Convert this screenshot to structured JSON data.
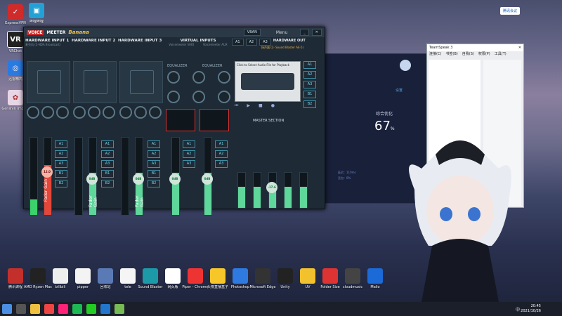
{
  "desktop_left": [
    {
      "label": "ExpressVPN",
      "color": "#d02b2b",
      "t": "✓"
    },
    {
      "label": "VRChat",
      "color": "#222",
      "t": "VR"
    },
    {
      "label": "迅雷精简",
      "color": "#2a7ae2",
      "t": "◎"
    },
    {
      "label": "Genshin Impact",
      "color": "#e8e0e8",
      "t": "✿"
    }
  ],
  "desktop_top2": {
    "label": "哔哩哔哩",
    "color": "#23a1d6"
  },
  "vm": {
    "logo": "VOICE",
    "logo2": "MEETER",
    "banana": "Banana",
    "vban": "VBAN",
    "menu": "Menu",
    "hw_in_1": "HARDWARE INPUT 1",
    "hw_in_1_sub": "麦克风 (2-NDA Broadcast)",
    "hw_in_2": "HARDWARE INPUT 2",
    "hw_in_3": "HARDWARE INPUT 3",
    "virt": "VIRTUAL INPUTS",
    "virt_a": "Voicemeeter VAIO",
    "virt_b": "Voicemeeter AUX",
    "hw_out": "HARDWARE OUT",
    "hw_out_sub": "扬声器 (2- Sound Blaster AE-5)",
    "a1": "A1",
    "a2": "A2",
    "a3": "A3",
    "b1": "B1",
    "b2": "B2",
    "intellipan": "INTELLIPAN",
    "voice": "VOICE",
    "colorpanel": "Color Panel",
    "fx": "fx echo",
    "comp": "Comp.",
    "gate": "Gate",
    "subbuddy": "SUBBUDDY",
    "denoiser": "Denoiser",
    "equalizer": "EQUALIZER",
    "fader_gain": "Fader Gain",
    "master": "MASTER SECTION",
    "gain1": "12.0",
    "gain": "0dB",
    "tape": "Click to Select Audio File for Playback",
    "mout": "Fader Gain",
    "mval": "-17.6"
  },
  "app": {
    "percent": "67",
    "label": "综合优化",
    "set": "设置",
    "stat": "延迟：110ms",
    "stat2": "丢包：0%"
  },
  "ts": {
    "title": "TeamSpeak 3",
    "menus": [
      "连接(C)",
      "书签(B)",
      "自我(S)",
      "权限(P)",
      "工具(T)"
    ]
  },
  "qq": "腾讯会议",
  "desktop_bottom": [
    "腾讯课程",
    "AMD Ryzen Master",
    "bilibili",
    "pipper",
    "回收站",
    "tele",
    "Sound Blaster",
    "网页版",
    "Piper - Chrome",
    "头榜直播盒子",
    "Photoshop",
    "Microsoft Edge",
    "Unity",
    "UV",
    "Folder Size",
    "cloudmusic",
    "Mailo"
  ],
  "clock": {
    "time": "20:45",
    "date": "2021/10/26"
  },
  "lang": "中"
}
